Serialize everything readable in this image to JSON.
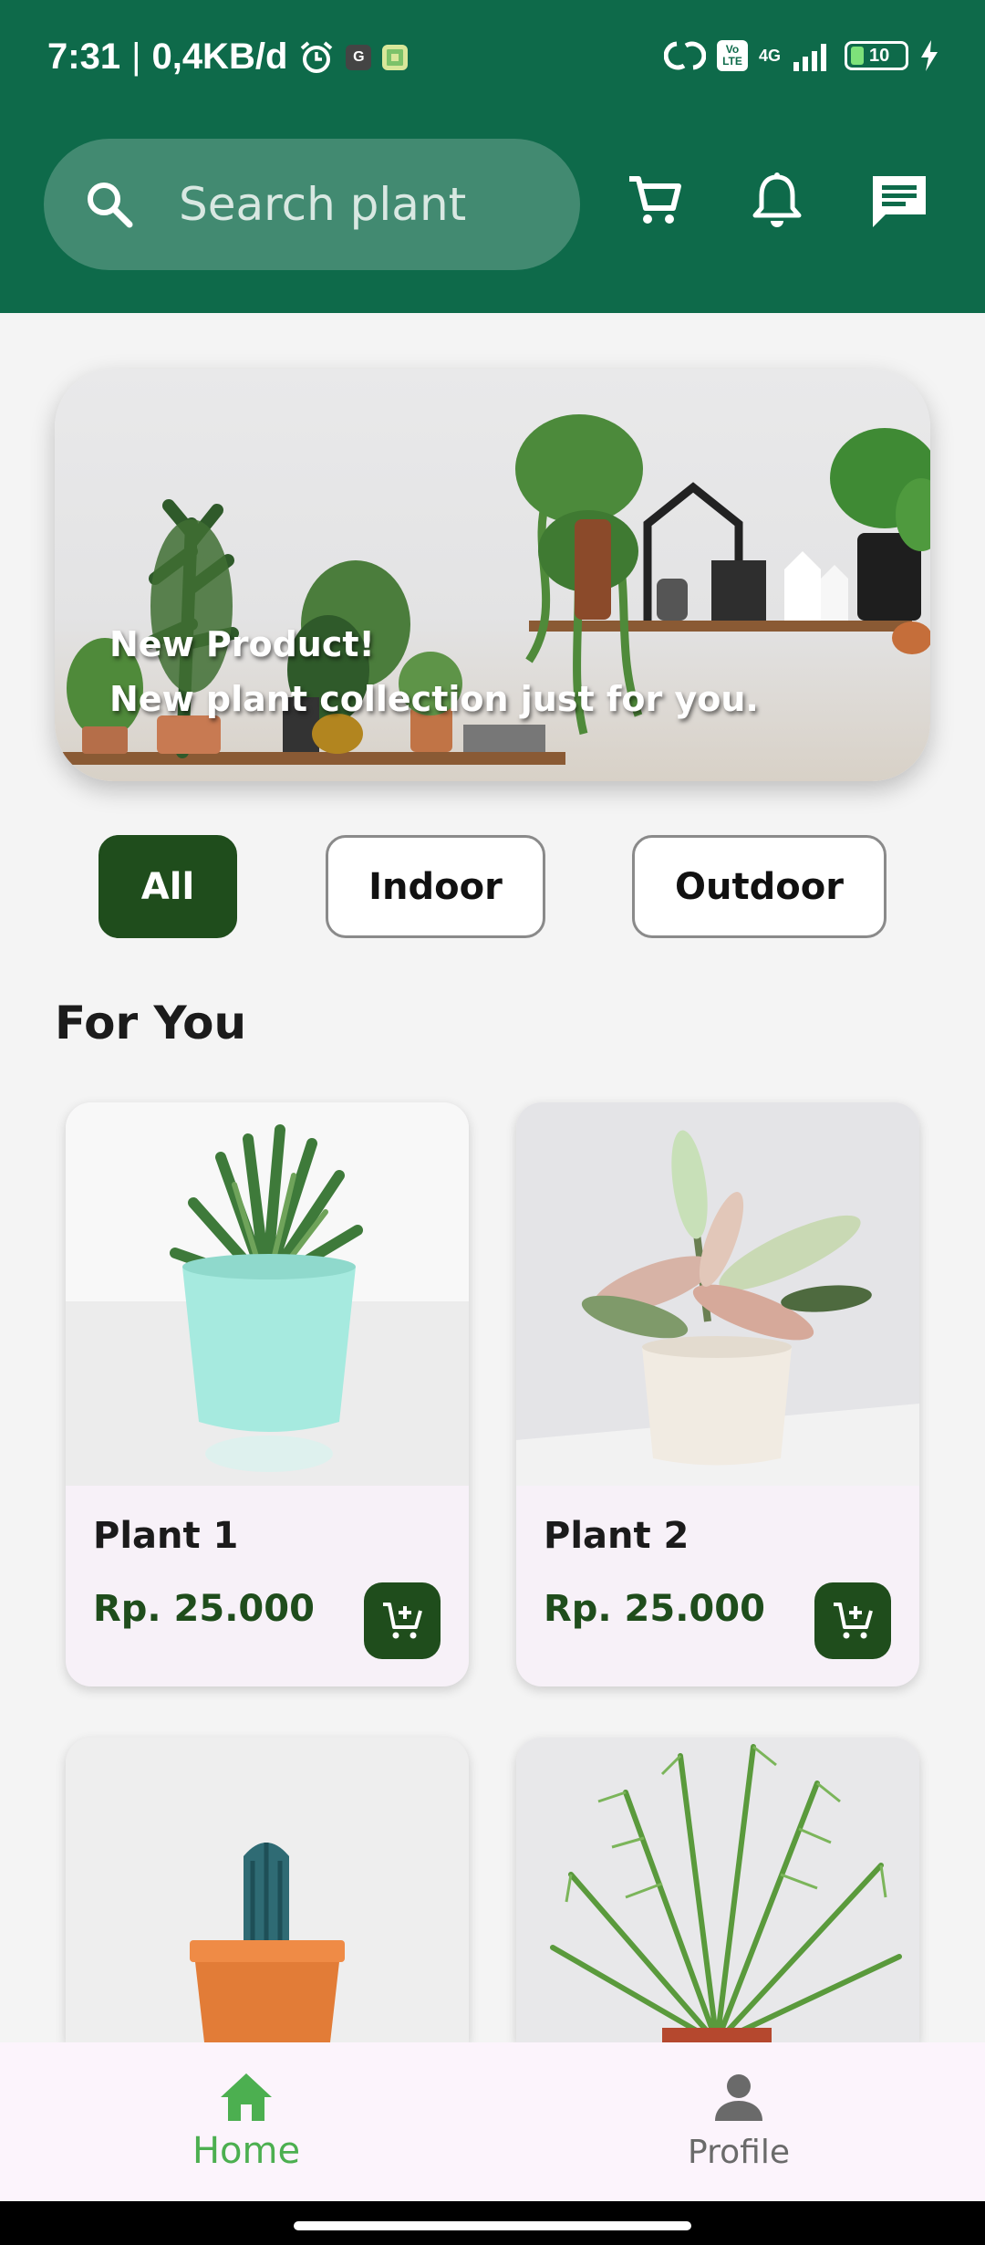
{
  "status_bar": {
    "time": "7:31",
    "separator": "|",
    "data_rate": "0,4KB/d",
    "icons": [
      "alarm-icon",
      "g-app-icon",
      "app-notification-icon",
      "hotspot-icon",
      "volte-icon",
      "4g-signal-icon",
      "battery-icon",
      "charging-icon"
    ],
    "volte": "Vo LTE",
    "network": "4G",
    "battery_level": "10"
  },
  "header": {
    "search_placeholder": "Search plant",
    "icons": [
      "search-icon",
      "cart-icon",
      "bell-icon",
      "chat-icon"
    ],
    "background": "#0e6a4a"
  },
  "banner": {
    "line1": "New Product!",
    "line2": "New plant collection just for you."
  },
  "filters": {
    "items": [
      {
        "label": "All",
        "active": true
      },
      {
        "label": "Indoor",
        "active": false
      },
      {
        "label": "Outdoor",
        "active": false
      }
    ],
    "active_color": "#1f4d1c"
  },
  "section": {
    "title": "For You"
  },
  "products": [
    {
      "name": "Plant 1",
      "price": "Rp. 25.000"
    },
    {
      "name": "Plant 2",
      "price": "Rp. 25.000"
    },
    {
      "name": "",
      "price": ""
    },
    {
      "name": "",
      "price": ""
    }
  ],
  "bottom_nav": {
    "items": [
      {
        "label": "Home",
        "icon": "home-icon",
        "active": true,
        "color": "#4caf50"
      },
      {
        "label": "Profile",
        "icon": "person-icon",
        "active": false,
        "color": "#6a6a6a"
      }
    ]
  }
}
